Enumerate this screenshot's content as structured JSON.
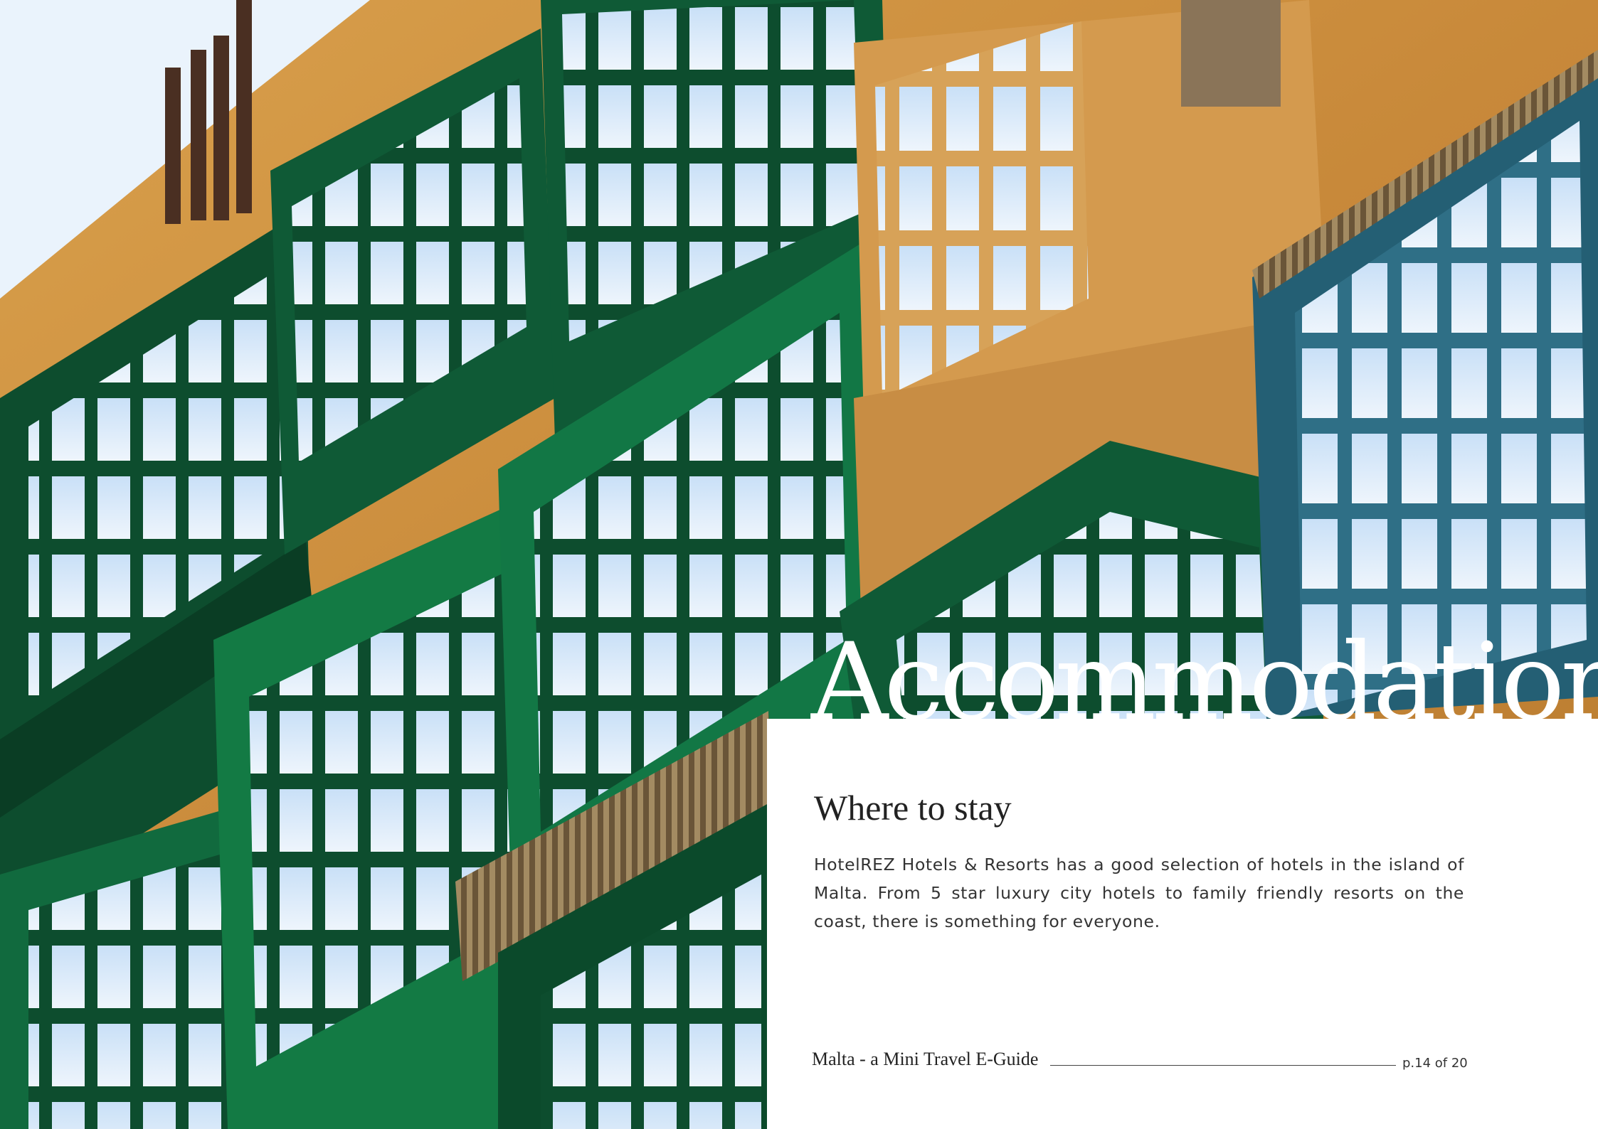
{
  "hero": {
    "title": "Accommodation",
    "image_description_icon": "balcony-photo"
  },
  "content": {
    "heading": "Where to stay",
    "paragraph": "HotelREZ Hotels & Resorts has a good selection of hotels in the island of Malta. From 5 star luxury city hotels to family friendly resorts on the coast, there is something for everyone."
  },
  "footer": {
    "guide_title": "Malta - a Mini Travel E-Guide",
    "page_label": "p.14 of 20"
  },
  "colors": {
    "panel_background": "#ffffff",
    "title_text": "#ffffff",
    "body_text": "#333333",
    "stone": "#c98a34",
    "balcony_green": "#0f5a36",
    "sky": "#e6f1fb"
  }
}
